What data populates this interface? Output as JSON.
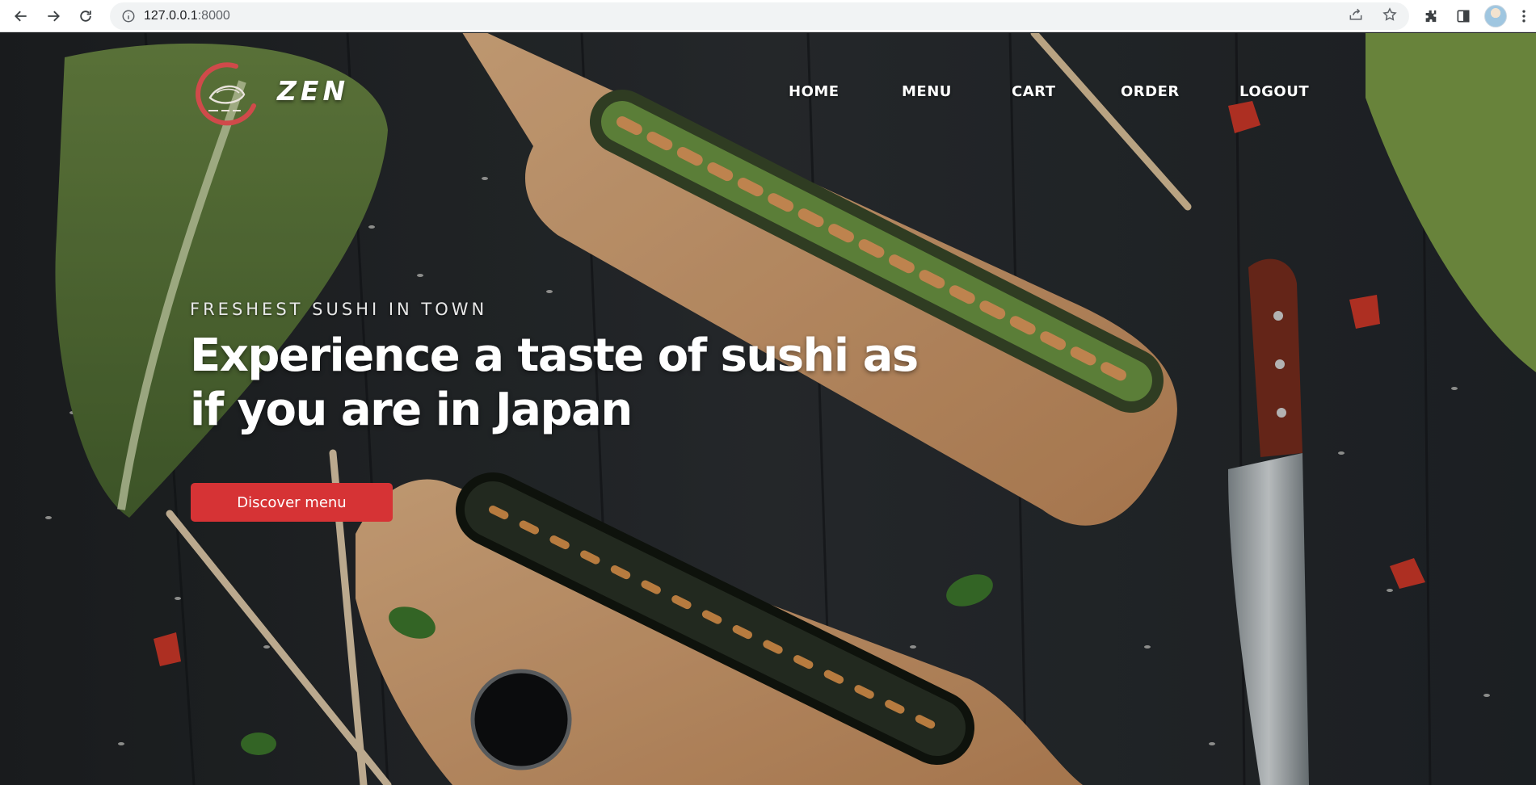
{
  "browser": {
    "url_host": "127.0.0.1",
    "url_port": ":8000",
    "icons": [
      "back-icon",
      "forward-icon",
      "reload-icon",
      "site-info-icon",
      "share-icon",
      "bookmark-star-icon",
      "extensions-icon",
      "side-panel-icon",
      "profile-avatar",
      "more-menu-icon"
    ]
  },
  "site": {
    "logo_text": "ZEN",
    "nav": {
      "home": "HOME",
      "menu": "MENU",
      "cart": "CART",
      "order": "ORDER",
      "logout": "LOGOUT"
    },
    "hero": {
      "eyebrow": "FRESHEST SUSHI IN TOWN",
      "headline": "Experience a taste of sushi as if you are in Japan",
      "cta": "Discover menu"
    }
  },
  "colors": {
    "accent": "#d63335",
    "text": "#ffffff",
    "wood_dark": "#25282b"
  }
}
